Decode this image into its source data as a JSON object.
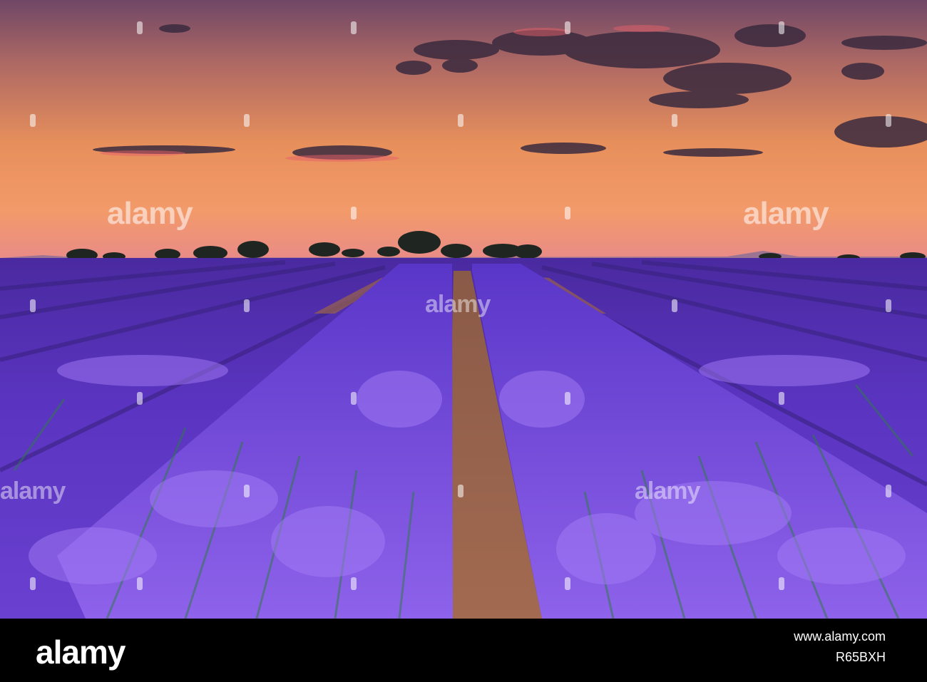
{
  "photo": {
    "subject": "lavender-field-at-sunset",
    "colors": {
      "sky_top": "#7a4a6e",
      "sky_mid": "#e08a5a",
      "sky_horizon": "#f2a070",
      "lavender": "#6a3fd0",
      "lavender_light": "#9a6ef0",
      "soil": "#a86a4a",
      "trees": "#1f2a22"
    }
  },
  "watermarks": {
    "primary_text": "alamy"
  },
  "footer": {
    "logo": "alamy",
    "image_id": "R65BXH",
    "url": "www.alamy.com"
  }
}
